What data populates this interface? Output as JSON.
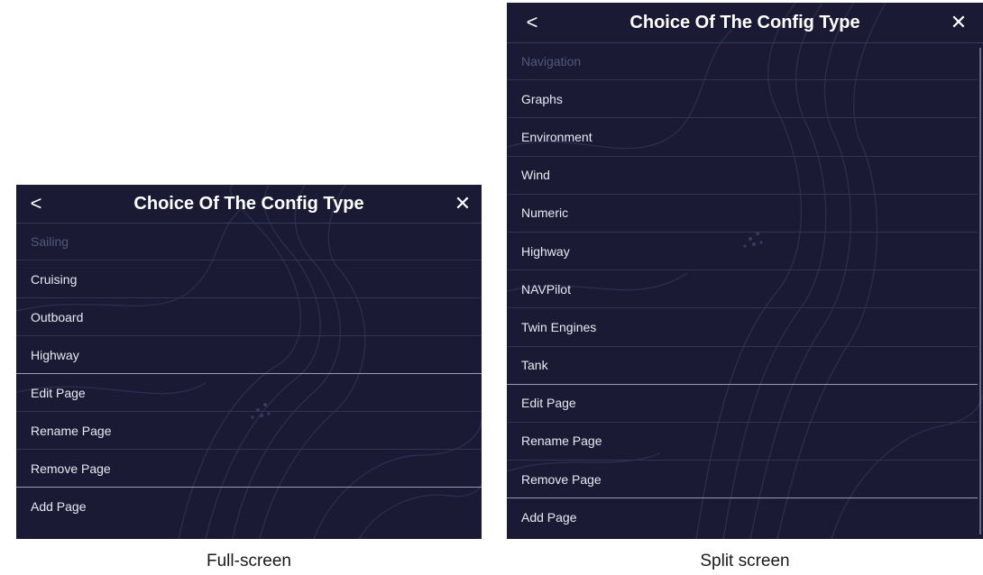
{
  "full": {
    "title": "Choice Of The Config Type",
    "back": "<",
    "close": "✕",
    "items": [
      {
        "label": "Sailing"
      },
      {
        "label": "Cruising"
      },
      {
        "label": "Outboard"
      },
      {
        "label": "Highway"
      },
      {
        "label": "Edit Page"
      },
      {
        "label": "Rename Page"
      },
      {
        "label": "Remove Page"
      },
      {
        "label": "Add Page"
      }
    ],
    "caption": "Full-screen"
  },
  "split": {
    "title": "Choice Of The Config Type",
    "back": "<",
    "close": "✕",
    "items": [
      {
        "label": "Navigation"
      },
      {
        "label": "Graphs"
      },
      {
        "label": "Environment"
      },
      {
        "label": "Wind"
      },
      {
        "label": "Numeric"
      },
      {
        "label": "Highway"
      },
      {
        "label": "NAVPilot"
      },
      {
        "label": "Twin Engines"
      },
      {
        "label": "Tank"
      },
      {
        "label": "Edit Page"
      },
      {
        "label": "Rename Page"
      },
      {
        "label": "Remove Page"
      },
      {
        "label": "Add Page"
      }
    ],
    "caption": "Split screen"
  }
}
